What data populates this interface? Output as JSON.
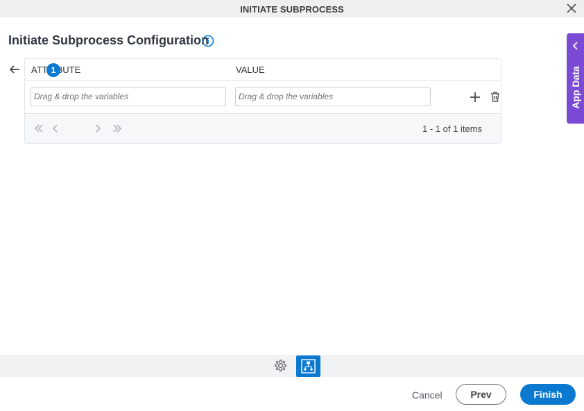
{
  "dialog": {
    "title": "INITIATE SUBPROCESS"
  },
  "page": {
    "heading": "Initiate Subprocess Configuration"
  },
  "grid": {
    "columns": [
      "ATTRIBUTE",
      "VALUE"
    ],
    "rows": [
      {
        "attribute_placeholder": "Drag & drop the variables",
        "value_placeholder": "Drag & drop the variables"
      }
    ],
    "pager": {
      "current_page": "1",
      "summary": "1 - 1 of 1 items"
    }
  },
  "side_panel": {
    "label": "App Data"
  },
  "footer": {
    "cancel_label": "Cancel",
    "prev_label": "Prev",
    "finish_label": "Finish"
  },
  "icons": {
    "close": "close-icon",
    "info": "info-icon",
    "back": "arrow-left-icon",
    "add": "plus-icon",
    "delete": "trash-icon",
    "first": "double-chevron-left-icon",
    "prev": "chevron-left-icon",
    "next": "chevron-right-icon",
    "last": "double-chevron-right-icon",
    "collapse": "chevron-left-icon",
    "settings": "gear-icon",
    "flow": "process-flow-icon"
  },
  "colors": {
    "accent": "#0b79d0",
    "side_panel": "#7b4bd6",
    "title_bar": "#eeeff1"
  }
}
